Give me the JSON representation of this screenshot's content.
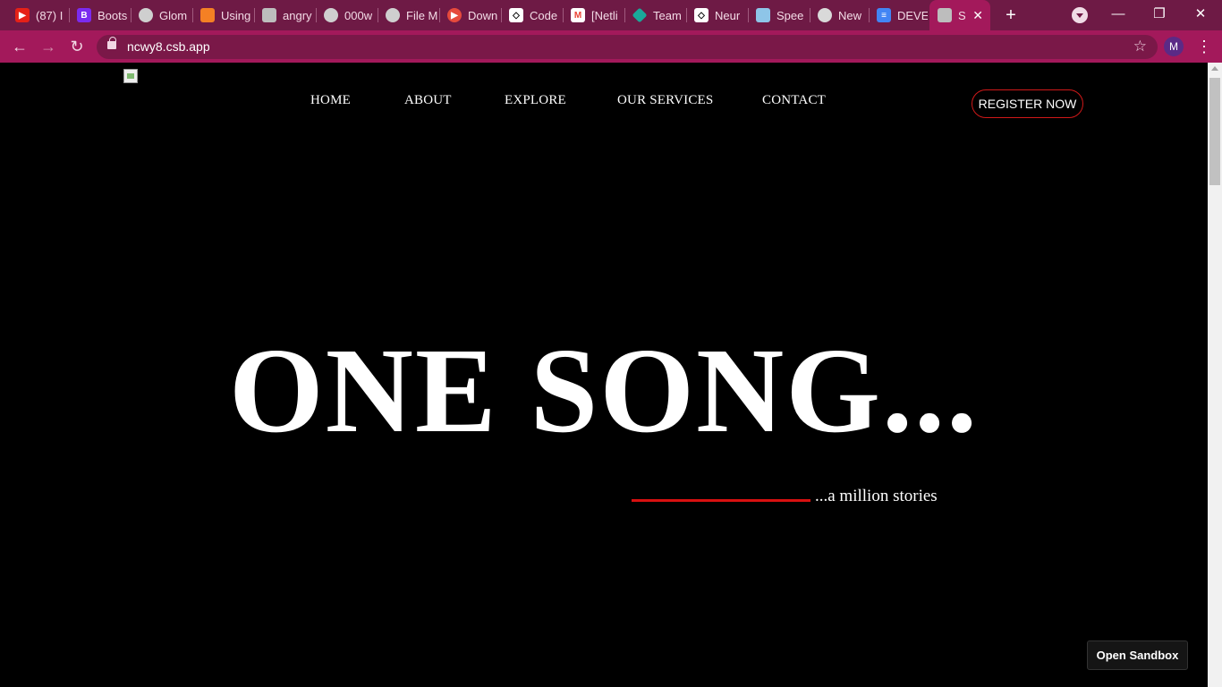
{
  "browser": {
    "tabs": [
      {
        "title": "(87) I",
        "icon": "youtube-icon",
        "color": "#e62117"
      },
      {
        "title": "Boots",
        "icon": "bootstrap-icon",
        "color": "#7b2bf0"
      },
      {
        "title": "Glom",
        "icon": "globe-icon",
        "color": "#cfcfcf"
      },
      {
        "title": "Using",
        "icon": "stackoverflow-icon",
        "color": "#f48024"
      },
      {
        "title": "angry",
        "icon": "codesandbox-icon",
        "color": "#bdbdbd"
      },
      {
        "title": "000w",
        "icon": "globe-icon",
        "color": "#cfcfcf"
      },
      {
        "title": "File M",
        "icon": "globe-icon",
        "color": "#cfcfcf"
      },
      {
        "title": "Down",
        "icon": "play-icon",
        "color": "#e64a3c"
      },
      {
        "title": "Code",
        "icon": "codepen-icon",
        "color": "#ffffff"
      },
      {
        "title": "[Netli",
        "icon": "gmail-icon",
        "color": "#ea4335"
      },
      {
        "title": "Team",
        "icon": "diamond-icon",
        "color": "#19a99a"
      },
      {
        "title": "Neur",
        "icon": "codepen-icon",
        "color": "#ffffff"
      },
      {
        "title": "Spee",
        "icon": "image-icon",
        "color": "#8ec5e8"
      },
      {
        "title": "New",
        "icon": "chrome-icon",
        "color": "#d9d9d9"
      },
      {
        "title": "DEVE",
        "icon": "docs-icon",
        "color": "#4285f4"
      },
      {
        "title": "SY",
        "icon": "codesandbox-icon",
        "color": "#bdbdbd"
      }
    ],
    "url": "ncwy8.csb.app",
    "profile_initial": "M"
  },
  "nav": {
    "home": "HOME",
    "about": "ABOUT",
    "explore": "EXPLORE",
    "services": "OUR SERVICES",
    "contact": "CONTACT"
  },
  "register_label": "REGISTER NOW",
  "hero": {
    "title": "ONE SONG...",
    "subtitle": "...a million stories"
  },
  "open_sandbox_label": "Open Sandbox",
  "colors": {
    "accent_red": "#d81010",
    "tabstrip": "#6e1a45",
    "toolbar": "#a3195b"
  }
}
